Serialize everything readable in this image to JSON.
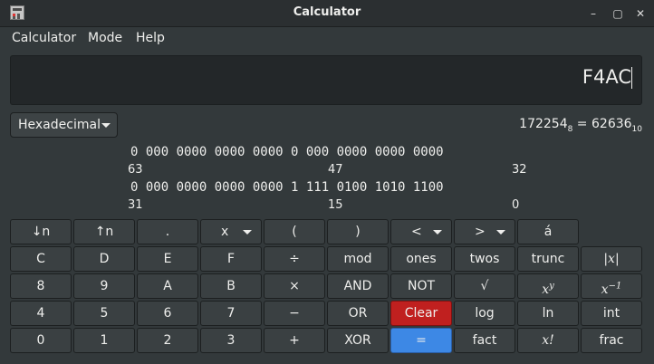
{
  "window": {
    "title": "Calculator"
  },
  "menu": {
    "calculator": "Calculator",
    "mode": "Mode",
    "help": "Help"
  },
  "display": {
    "value": "F4AC"
  },
  "mode_select": {
    "selected": "Hexadecimal"
  },
  "conversion": {
    "octal": "172254",
    "octal_base": "8",
    "equals": " = ",
    "decimal": "62636",
    "decimal_base": "10"
  },
  "bits": {
    "row1": "0 000 0000 0000 0000 0 000 0000 0000 0000",
    "row1_labels": [
      "63",
      "47",
      "32"
    ],
    "row2": "0 000 0000 0000 0000 1 111 0100 1010 1100",
    "row2_labels": [
      "31",
      "15",
      "0"
    ]
  },
  "buttons": {
    "row1": [
      "↓n",
      "↑n",
      ".",
      "x",
      "(",
      ")",
      "<",
      ">",
      "á"
    ],
    "row2": [
      "C",
      "D",
      "E",
      "F",
      "÷",
      "mod",
      "ones",
      "twos",
      "trunc",
      "|x|"
    ],
    "row3": [
      "8",
      "9",
      "A",
      "B",
      "×",
      "AND",
      "NOT",
      "√",
      "x^y",
      "x^−1"
    ],
    "row4": [
      "4",
      "5",
      "6",
      "7",
      "−",
      "OR",
      "Clear",
      "log",
      "ln",
      "int"
    ],
    "row5": [
      "0",
      "1",
      "2",
      "3",
      "+",
      "XOR",
      "=",
      "fact",
      "x!",
      "frac"
    ]
  }
}
